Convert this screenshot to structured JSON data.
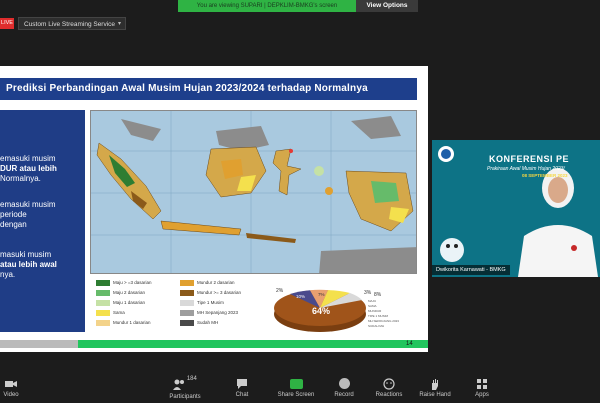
{
  "topbar": {
    "viewing_banner": "You are viewing SUPARI | DEPKLIM-BMKG's screen",
    "view_options": "View Options",
    "live_badge": "LIVE",
    "stream_select": "Custom Live Streaming Service"
  },
  "slide": {
    "title": "Prediksi Perbandingan Awal Musim Hujan 2023/2024 terhadap Normalnya",
    "left_text": [
      "emasuki musim",
      "DUR atau lebih",
      "Normalnya.",
      "emasuki musim",
      "periode",
      "dengan",
      "masuki musim",
      "atau lebih awal",
      "nya."
    ],
    "legend": [
      {
        "label": "Maju > =3 dasarian",
        "color": "#2e7d32"
      },
      {
        "label": "Maju 2 dasarian",
        "color": "#66bb6a"
      },
      {
        "label": "Maju 1 dasarian",
        "color": "#c5e1a5"
      },
      {
        "label": "Sama",
        "color": "#f4e04d"
      },
      {
        "label": "Mundur 1 dasarian",
        "color": "#f3d38a"
      },
      {
        "label": "Mundur 2 dasarian",
        "color": "#e0a030"
      },
      {
        "label": "Mundur >= 3 dasarian",
        "color": "#8b5a1a"
      },
      {
        "label": "Tipe 1 Musim",
        "color": "#d9d9d9"
      },
      {
        "label": "MH Sepanjang 2023",
        "color": "#9e9e9e"
      },
      {
        "label": "Sudah MH",
        "color": "#4a4a4a"
      }
    ],
    "pie": {
      "center_label": "64%",
      "labels": [
        "2%",
        "10%",
        "7%",
        "3%",
        "8%"
      ],
      "legend_items": [
        "MAJU",
        "SAMA",
        "MUNDUR",
        "TIPE 1 MUSIM",
        "MH SEPANJANG 2023",
        "SUDAH MH"
      ]
    },
    "slide_number": "14"
  },
  "video": {
    "conference_title": "KONFERENSI PE",
    "conference_subtitle": "Prakiraan Awal Musim Hujan 2023/",
    "conference_date": "08 SEPTEMBER 2023",
    "speaker_name": "Dwikorita Karnawati - BMKG"
  },
  "toolbar": {
    "video_label": "Video",
    "participants_label": "Participants",
    "participants_count": "184",
    "chat_label": "Chat",
    "share_label": "Share Screen",
    "record_label": "Record",
    "reactions_label": "Reactions",
    "raise_hand_label": "Raise Hand",
    "apps_label": "Apps"
  }
}
